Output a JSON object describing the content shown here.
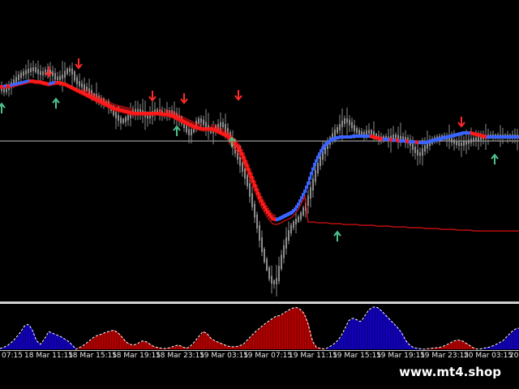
{
  "watermark": "www.mt4.shop",
  "colors": {
    "background": "#000000",
    "candles": "#8c8c8c",
    "band_down": "#ff1a1a",
    "band_up": "#3a64ff",
    "signal_line": "#e01010",
    "arrow_sell": "#ff2a2a",
    "arrow_buy": "#4fc28a",
    "hist_up": "#1400d0",
    "hist_down": "#c80000",
    "hist_outline": "#ffffff",
    "level_line": "#bfbfbf"
  },
  "icons": {
    "sell": "arrow-down-icon",
    "buy": "arrow-up-icon"
  },
  "time_axis": {
    "labels": [
      "07:15",
      "18 Mar 11:15",
      "18 Mar 15:15",
      "18 Mar 19:15",
      "18 Mar 23:15",
      "19 Mar 03:15",
      "19 Mar 07:15",
      "19 Mar 11:15",
      "19 Mar 15:15",
      "19 Mar 19:15",
      "19 Mar 23:15",
      "20 Mar 03:15",
      "20"
    ]
  },
  "chart_data": [
    {
      "type": "line",
      "x": [
        0,
        4,
        8,
        12,
        16,
        20,
        24,
        28,
        32,
        36,
        40,
        44,
        48,
        52,
        56,
        60,
        64,
        68,
        72,
        76,
        80,
        84,
        88,
        92,
        96,
        100,
        104,
        108,
        112,
        116,
        120,
        124,
        128,
        132,
        136,
        140,
        144,
        148,
        152,
        156,
        160,
        164,
        168,
        172,
        176,
        180,
        184,
        188,
        192,
        196,
        200,
        204,
        208,
        212,
        216,
        220,
        224,
        228,
        232,
        236,
        240,
        244,
        248,
        252,
        256,
        260,
        264,
        268,
        272,
        276,
        280,
        284,
        288,
        292,
        296,
        300,
        304,
        308,
        312,
        316,
        320,
        324,
        328,
        332,
        336,
        340,
        344,
        348,
        352,
        356,
        360,
        364,
        368,
        372,
        376,
        380,
        384,
        388,
        392,
        396,
        400,
        404,
        408,
        412,
        416,
        420,
        424,
        428,
        432,
        436,
        440,
        444,
        448,
        452,
        456,
        460,
        464,
        468,
        472,
        476,
        480,
        484,
        488,
        492,
        496,
        500,
        504,
        508,
        512,
        516,
        520,
        524,
        528,
        532,
        536,
        540,
        544,
        548,
        552,
        556,
        560,
        564,
        568,
        572,
        576,
        580,
        584,
        588,
        592,
        596,
        600,
        604,
        608,
        612,
        616,
        620,
        624,
        628,
        632,
        636,
        640
      ],
      "series": [
        {
          "values": [
            110,
            112,
            108,
            105,
            100,
            96,
            92,
            90,
            88,
            86,
            85,
            88,
            91,
            90,
            87,
            89,
            92,
            98,
            96,
            94,
            88,
            85,
            90,
            100,
            104,
            106,
            110,
            112,
            117,
            118,
            122,
            125,
            127,
            130,
            135,
            142,
            146,
            150,
            148,
            145,
            140,
            137,
            136,
            138,
            140,
            145,
            142,
            138,
            136,
            139,
            142,
            140,
            138,
            140,
            143,
            147,
            152,
            160,
            165,
            160,
            152,
            148,
            150,
            155,
            160,
            163,
            160,
            155,
            152,
            158,
            165,
            175,
            185,
            195,
            205,
            215,
            228,
            245,
            262,
            280,
            300,
            318,
            332,
            346,
            350,
            345,
            325,
            308,
            295,
            283,
            276,
            272,
            268,
            260,
            252,
            240,
            226,
            212,
            200,
            190,
            182,
            175,
            168,
            162,
            158,
            152,
            148,
            150,
            155,
            160,
            163,
            165,
            165,
            162,
            163,
            167,
            170,
            171,
            170,
            171,
            170,
            168,
            169,
            170,
            171,
            172,
            176,
            183,
            188,
            192,
            185,
            180,
            176,
            173,
            171,
            170,
            169,
            170,
            172,
            174,
            176,
            178,
            178,
            176,
            175,
            173,
            172,
            171,
            170,
            169,
            168
          ]
        },
        {
          "values": [
            107,
            107,
            106,
            106,
            105,
            104,
            103,
            102,
            101,
            100,
            100,
            101,
            101,
            102,
            103,
            104,
            103,
            102,
            102,
            103,
            104,
            106,
            108,
            110,
            112,
            114,
            116,
            118,
            120,
            122,
            124,
            126,
            128,
            130,
            132,
            134,
            135,
            136,
            137,
            138,
            139,
            140,
            140,
            140,
            140,
            140,
            140,
            140,
            140,
            140,
            141,
            141,
            142,
            143,
            145,
            147,
            149,
            151,
            153,
            155,
            157,
            158,
            159,
            159,
            159,
            159,
            160,
            162,
            164,
            166,
            168,
            172,
            176,
            180,
            186,
            194,
            204,
            214,
            224,
            234,
            244,
            252,
            259,
            265,
            270,
            271,
            270,
            268,
            266,
            264,
            262,
            258,
            252,
            244,
            236,
            226,
            214,
            203,
            194,
            186,
            180,
            176,
            173,
            171,
            170,
            169,
            169,
            169,
            169,
            168,
            168,
            168,
            168,
            168,
            168,
            169,
            170,
            171,
            172,
            172,
            172,
            173,
            173,
            174,
            174,
            174,
            175,
            175,
            175,
            176,
            176,
            176,
            175,
            174,
            173,
            172,
            171,
            170,
            169,
            168,
            167,
            166,
            165,
            164,
            164,
            164,
            165,
            166,
            167,
            168,
            169
          ]
        },
        {
          "values": [
            109,
            109,
            108,
            107,
            106,
            105,
            104,
            103,
            103,
            103,
            104,
            105,
            106,
            107,
            108,
            110,
            112,
            115,
            118,
            121,
            124,
            127,
            130,
            133,
            136,
            138,
            139,
            140,
            141,
            142,
            143,
            144,
            145,
            146,
            147,
            148,
            149,
            150,
            151,
            153,
            155,
            158,
            162,
            167,
            173,
            180,
            188,
            197,
            207,
            218,
            229,
            240,
            250,
            258,
            264,
            269,
            272,
            274,
            275,
            276,
            276,
            276,
            276,
            276,
            275,
            274,
            274,
            273,
            273,
            273,
            272,
            272,
            271,
            271,
            270,
            270,
            270,
            270,
            270,
            270,
            270,
            271,
            271,
            271,
            272,
            272,
            272,
            272,
            272,
            273,
            273,
            273,
            273,
            274,
            274,
            274,
            274,
            274,
            275,
            275,
            275,
            275,
            276,
            276,
            276,
            276,
            277,
            277,
            277,
            277,
            277,
            278,
            278,
            278,
            278,
            278,
            279,
            279,
            279,
            279,
            279,
            280,
            280,
            280,
            280,
            280,
            281,
            281,
            281,
            281,
            281,
            282,
            282,
            282,
            282,
            282,
            283,
            283,
            283,
            283,
            283,
            284,
            284,
            284,
            284,
            284,
            285,
            285,
            285,
            285,
            285
          ]
        }
      ]
    },
    {
      "type": "area",
      "x": [
        0,
        5,
        10,
        15,
        20,
        25,
        30,
        35,
        40,
        45,
        50,
        55,
        60,
        65,
        70,
        75,
        80,
        85,
        90,
        95,
        100,
        105,
        110,
        115,
        120,
        125,
        130,
        135,
        140,
        145,
        150,
        155,
        160,
        165,
        170,
        175,
        180,
        185,
        190,
        195,
        200,
        205,
        210,
        215,
        220,
        225,
        230,
        235,
        240,
        245,
        250,
        255,
        260,
        265,
        270,
        275,
        280,
        285,
        290,
        295,
        300,
        305,
        310,
        315,
        320,
        325,
        330,
        335,
        340,
        345,
        350,
        355,
        360,
        365,
        370,
        375,
        380,
        385,
        390,
        395,
        400,
        405,
        410,
        415,
        420,
        425,
        430,
        435,
        440,
        445,
        450,
        455,
        460,
        465,
        470,
        475,
        480,
        485,
        490,
        495,
        500,
        505,
        510,
        515,
        520,
        525,
        530,
        535,
        540,
        545,
        550,
        555,
        560,
        565,
        570,
        575,
        580,
        585,
        590,
        595,
        600,
        605,
        610,
        615,
        620,
        625,
        630,
        635,
        640
      ],
      "series": [
        {
          "values": [
            0.02,
            0.05,
            0.1,
            0.18,
            0.28,
            0.4,
            0.55,
            0.6,
            0.45,
            0.2,
            0.12,
            0.25,
            0.42,
            0.38,
            0.34,
            0.3,
            0.24,
            0.18,
            0.08,
            -0.02,
            -0.06,
            -0.12,
            -0.2,
            -0.28,
            -0.33,
            -0.36,
            -0.4,
            -0.43,
            -0.45,
            -0.4,
            -0.3,
            -0.18,
            -0.12,
            -0.1,
            -0.14,
            -0.2,
            -0.18,
            -0.12,
            -0.06,
            -0.04,
            -0.02,
            -0.02,
            -0.04,
            -0.08,
            -0.1,
            -0.06,
            -0.02,
            -0.08,
            -0.18,
            -0.3,
            -0.42,
            -0.38,
            -0.26,
            -0.2,
            -0.16,
            -0.12,
            -0.08,
            -0.06,
            -0.06,
            -0.08,
            -0.12,
            -0.22,
            -0.32,
            -0.42,
            -0.5,
            -0.58,
            -0.65,
            -0.72,
            -0.78,
            -0.8,
            -0.86,
            -0.92,
            -0.97,
            -1.0,
            -0.95,
            -0.85,
            -0.6,
            -0.2,
            -0.05,
            -0.02,
            -0.01,
            0.05,
            0.1,
            0.18,
            0.3,
            0.48,
            0.68,
            0.74,
            0.7,
            0.65,
            0.8,
            0.94,
            1.0,
            1.0,
            0.92,
            0.82,
            0.72,
            0.62,
            0.52,
            0.4,
            0.22,
            0.1,
            0.04,
            0.02,
            0.01,
            -0.01,
            -0.02,
            -0.03,
            -0.04,
            -0.06,
            -0.1,
            -0.15,
            -0.2,
            -0.22,
            -0.2,
            -0.14,
            -0.08,
            -0.02,
            0.0,
            0.02,
            0.04,
            0.06,
            0.1,
            0.15,
            0.2,
            0.3,
            0.4,
            0.48,
            0.5
          ]
        }
      ],
      "ylim": [
        -1,
        1
      ]
    }
  ],
  "signals": {
    "sell": [
      {
        "x": 60,
        "y": 92
      },
      {
        "x": 97,
        "y": 82
      },
      {
        "x": 188,
        "y": 122
      },
      {
        "x": 227,
        "y": 125
      },
      {
        "x": 294,
        "y": 121
      },
      {
        "x": 569,
        "y": 154
      }
    ],
    "buy": [
      {
        "x": 2,
        "y": 130
      },
      {
        "x": 69,
        "y": 124
      },
      {
        "x": 218,
        "y": 158
      },
      {
        "x": 286,
        "y": 172
      },
      {
        "x": 416,
        "y": 288
      },
      {
        "x": 610,
        "y": 193
      }
    ]
  }
}
